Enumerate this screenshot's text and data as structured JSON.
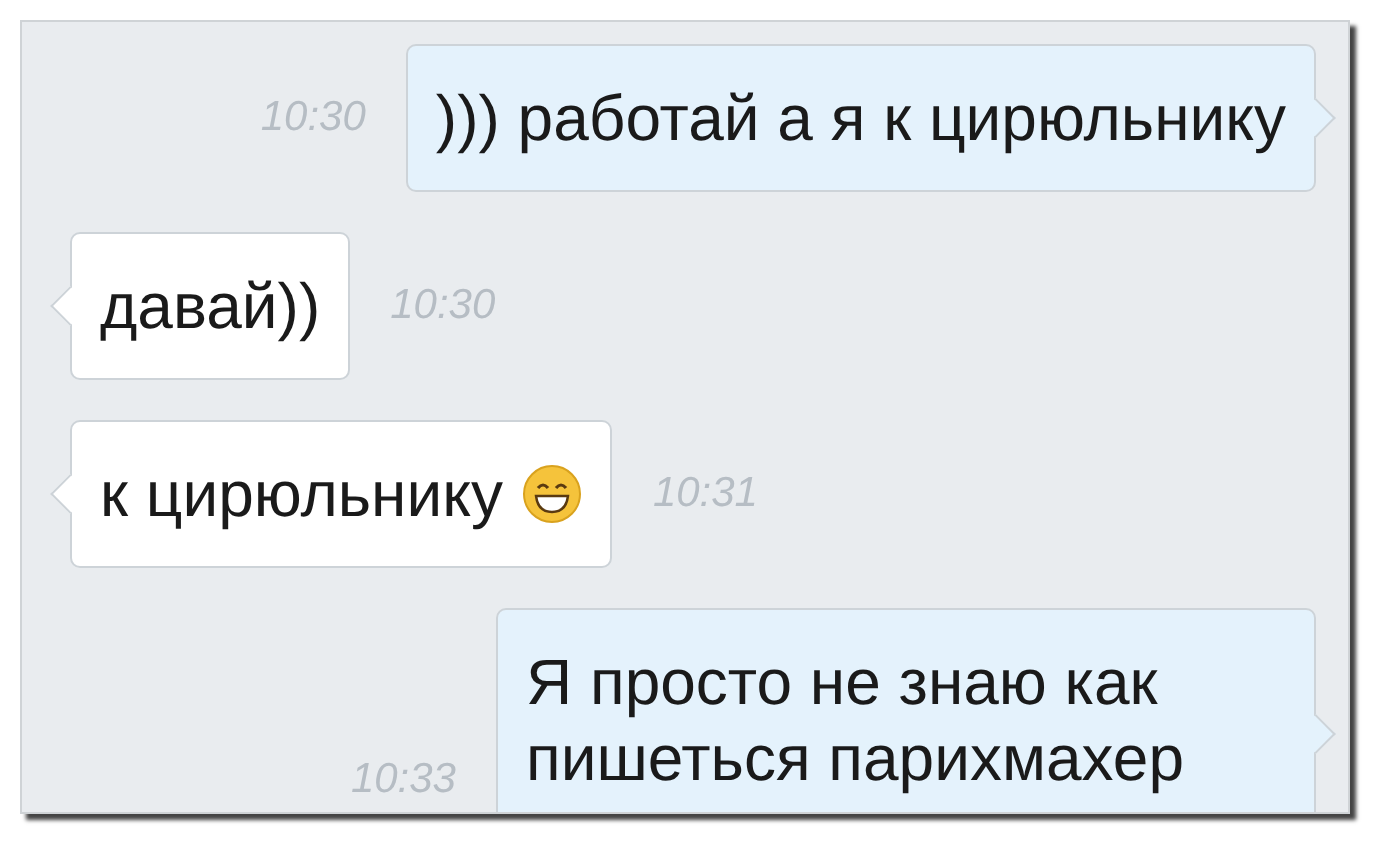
{
  "messages": [
    {
      "outgoing": true,
      "kind": "text",
      "text": "))) работай а я к цирюльнику",
      "time": "10:30"
    },
    {
      "outgoing": false,
      "kind": "text",
      "text": "давай))",
      "time": "10:30"
    },
    {
      "outgoing": false,
      "kind": "text_with_emoji",
      "text": "к цирюльнику",
      "time": "10:31"
    },
    {
      "outgoing": true,
      "kind": "text",
      "text": "Я просто не знаю как пишеться парихмахер",
      "time": "10:33"
    }
  ]
}
